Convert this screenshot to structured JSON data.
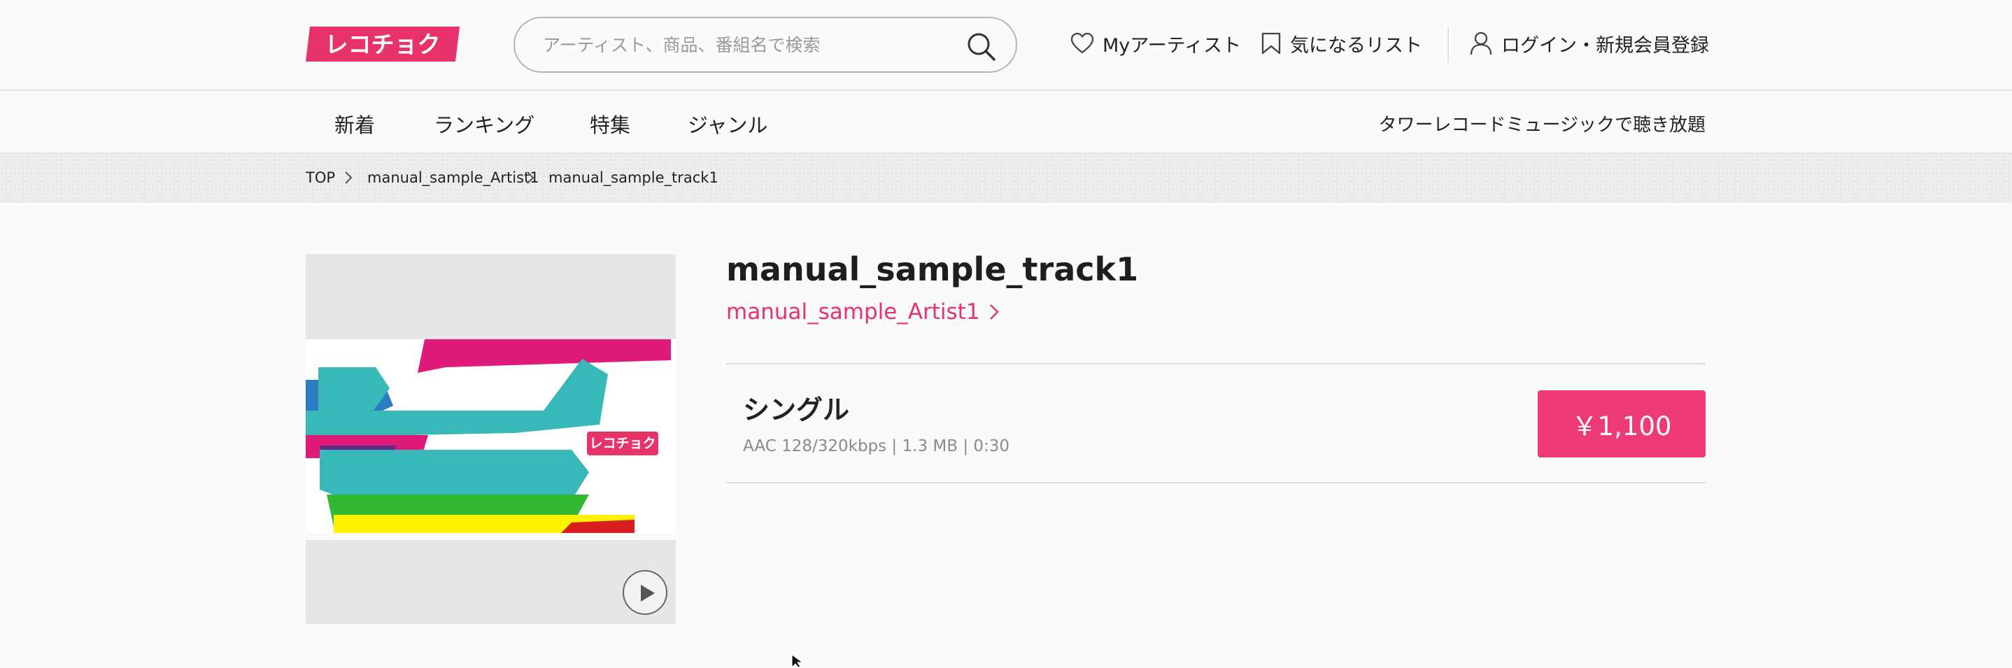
{
  "brand": {
    "logo_text": "レコチョク",
    "accent": "#e8326a"
  },
  "search": {
    "placeholder": "アーティスト、商品、番組名で検索"
  },
  "header_links": {
    "my_artist": "Myアーティスト",
    "wishlist": "気になるリスト",
    "login": "ログイン・新規会員登録"
  },
  "nav": {
    "items": [
      "新着",
      "ランキング",
      "特集",
      "ジャンル"
    ],
    "right_link": "タワーレコードミュージックで聴き放題"
  },
  "breadcrumb": [
    "TOP",
    "manual_sample_Artist1",
    "manual_sample_track1"
  ],
  "track": {
    "title": "manual_sample_track1",
    "artist": "manual_sample_Artist1",
    "format_label": "シングル",
    "spec": "AAC 128/320kbps | 1.3 MB | 0:30",
    "price": "￥1,100",
    "price_color": "#ef3a78"
  },
  "icons": [
    "search-icon",
    "heart-icon",
    "bookmark-icon",
    "user-icon",
    "chevron-right-icon",
    "play-icon"
  ]
}
